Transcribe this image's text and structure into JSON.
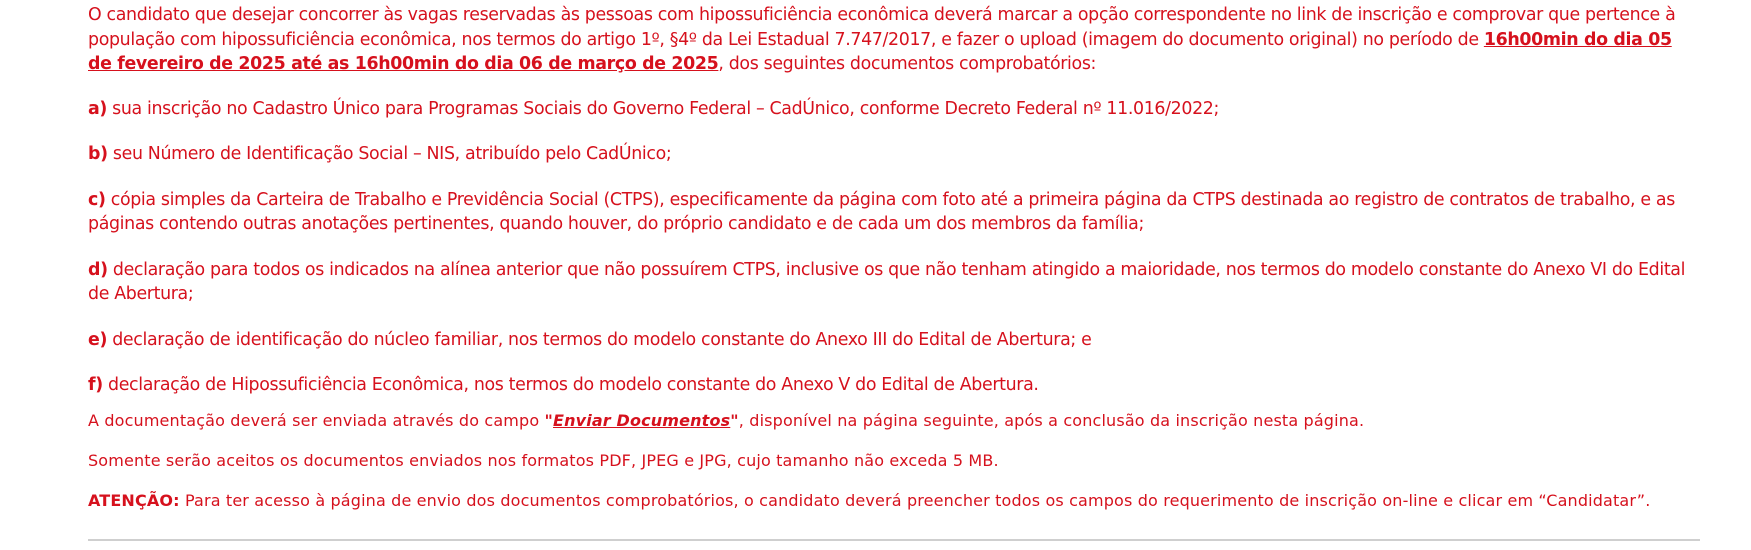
{
  "intro": {
    "text_before": "O candidato que desejar concorrer às vagas reservadas às pessoas com hipossuficiência econômica deverá marcar a opção correspondente no link de inscrição e comprovar que pertence à população com hipossuficiência econômica, nos termos do artigo 1º, §4º da Lei Estadual 7.747/2017, e fazer o upload (imagem do documento original) no período de ",
    "deadline": "16h00min do dia 05 de fevereiro de 2025 até as 16h00min do dia 06 de março de 2025",
    "text_after": ", dos seguintes documentos comprobatórios:"
  },
  "items": [
    {
      "letter": "a)",
      "text": " sua inscrição no Cadastro Único para Programas Sociais do Governo Federal – CadÚnico, conforme Decreto Federal nº 11.016/2022;"
    },
    {
      "letter": "b)",
      "text": " seu Número de Identificação Social – NIS, atribuído pelo CadÚnico;"
    },
    {
      "letter": "c)",
      "text": " cópia simples da Carteira de Trabalho e Previdência Social (CTPS), especificamente da página com foto até a primeira página da CTPS destinada ao registro de contratos de trabalho, e as páginas contendo outras anotações pertinentes, quando houver, do próprio candidato e de cada um dos membros da família;"
    },
    {
      "letter": "d)",
      "text": " declaração para todos os indicados na alínea anterior que não possuírem CTPS, inclusive os que não tenham atingido a maioridade, nos termos do modelo constante do Anexo VI do Edital de Abertura;"
    },
    {
      "letter": "e)",
      "text": " declaração de identificação do núcleo familiar, nos termos do modelo constante do Anexo III do Edital de Abertura; e"
    },
    {
      "letter": "f)",
      "text": " declaração de Hipossuficiência Econômica, nos termos do modelo constante do Anexo V do Edital de Abertura."
    }
  ],
  "upload_note": {
    "before": "A documentação deverá ser enviada através do campo ",
    "open_quote": "\"",
    "field_name": "Enviar Documentos",
    "close_quote": "\"",
    "after": ", disponível na página seguinte, após a conclusão da inscrição nesta página."
  },
  "formats_note": "Somente serão aceitos os documentos enviados nos formatos PDF, JPEG e JPG, cujo tamanho não exceda 5 MB.",
  "attention": {
    "label": "ATENÇÃO:",
    "text": " Para ter acesso à página de envio dos documentos comprobatórios, o candidato deverá preencher todos os campos do requerimento de inscrição on-line e clicar em “Candidatar”."
  },
  "colors": {
    "text": "#d6111d",
    "divider": "#cfcfcf"
  }
}
